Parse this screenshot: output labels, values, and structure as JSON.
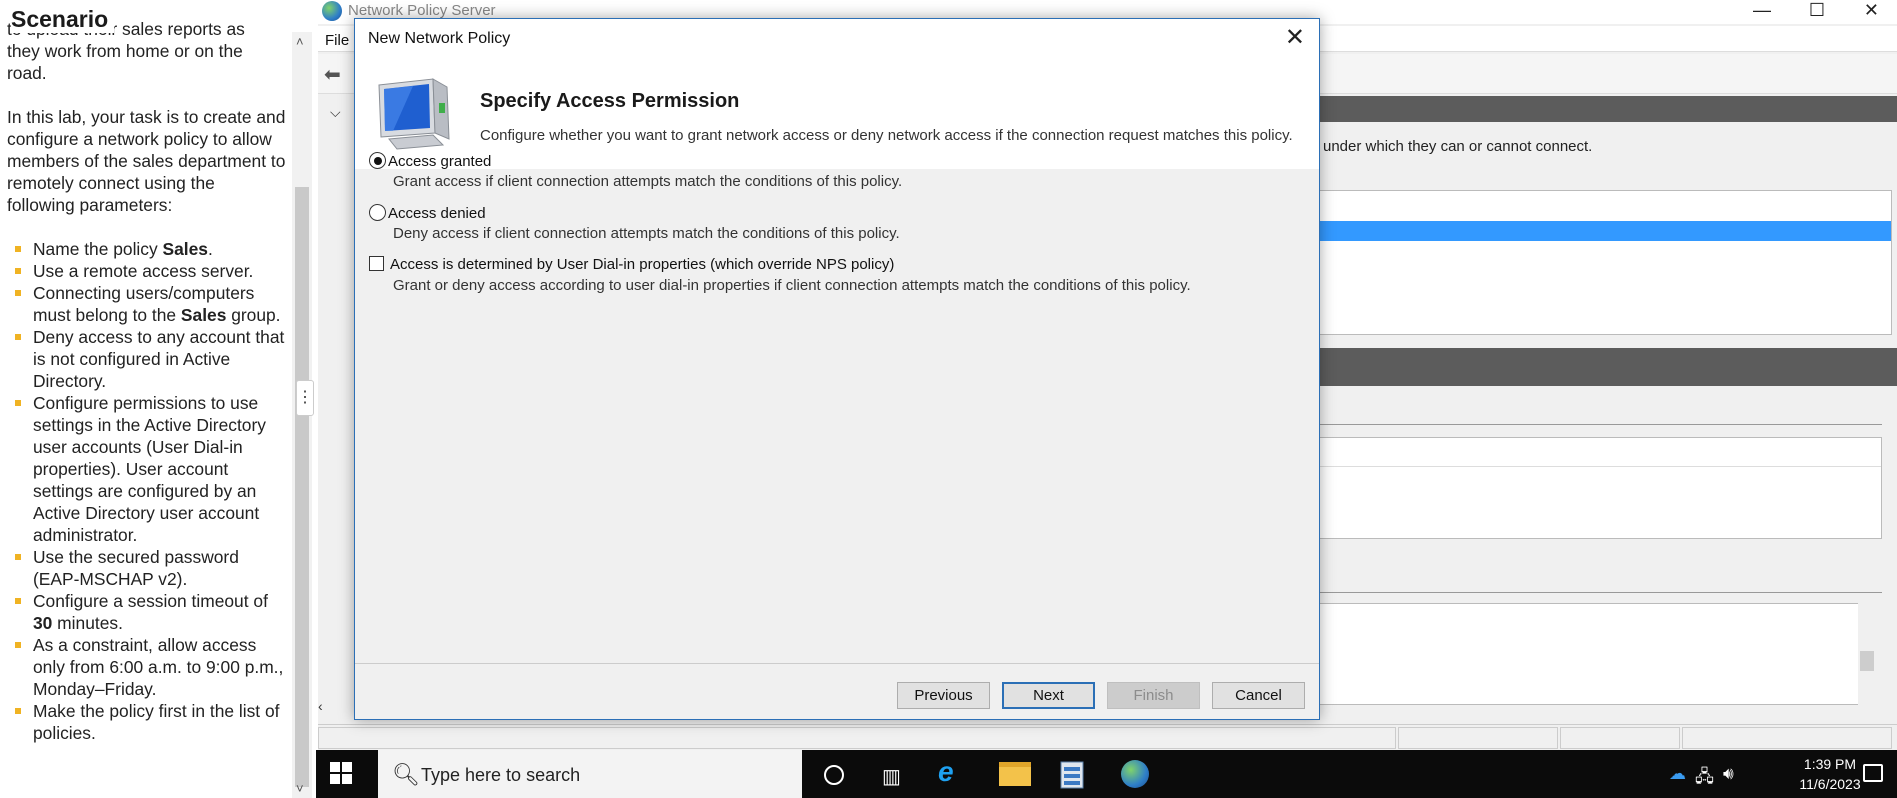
{
  "scenario": {
    "title": "Scenario",
    "cut_line": "to upload their sales reports as",
    "intro_tail": "they work from home or on the road.",
    "task_paragraph": "In this lab, your task is to create and configure a network policy to allow members of the sales department to remotely connect using the following parameters:",
    "bullets": {
      "b1_pre": "Name the policy ",
      "b1_bold": "Sales",
      "b1_post": ".",
      "b2": "Use a remote access server.",
      "b3_pre": "Connecting users/computers must belong to the ",
      "b3_bold": "Sales",
      "b3_post": " group.",
      "b4": "Deny access to any account that is not configured in Active Directory.",
      "b5": "Configure permissions to use settings in the Active Directory user accounts (User Dial-in properties). User account settings are configured by an Active Directory user account administrator.",
      "b6": "Use the secured password (EAP-MSCHAP v2).",
      "b7_pre": "Configure a session timeout of ",
      "b7_bold": "30",
      "b7_post": " minutes.",
      "b8": "As a constraint, allow access only from 6:00 a.m. to 9:00 p.m., Monday–Friday.",
      "b9": "Make the policy first in the list of policies."
    }
  },
  "nps_window": {
    "title": "Network Policy Server",
    "menu_file": "File",
    "description_fragment": "under which they can or cannot connect."
  },
  "dialog": {
    "title": "New Network Policy",
    "heading": "Specify Access Permission",
    "subheading": "Configure whether you want to grant network access or deny network access if the connection request matches this policy.",
    "options": {
      "granted_label": "Access granted",
      "granted_desc": "Grant access if client connection attempts match the conditions of this policy.",
      "denied_label": "Access denied",
      "denied_desc": "Deny access if client connection attempts match the conditions of this policy.",
      "dialin_label": "Access is determined by User Dial-in properties (which override NPS policy)",
      "dialin_desc": "Grant or deny access according to user dial-in properties if client connection attempts match the conditions of this policy."
    },
    "selected_option": "Access granted",
    "dialin_checked": false,
    "buttons": {
      "previous": "Previous",
      "next": "Next",
      "finish": "Finish",
      "cancel": "Cancel"
    }
  },
  "taskbar": {
    "search_placeholder": "Type here to search",
    "time": "1:39 PM",
    "date": "11/6/2023"
  },
  "colors": {
    "bullet": "#f0b323",
    "dialog_border": "#2b6fb6",
    "selection": "#3399ff",
    "taskbar": "#0b0b0b"
  }
}
